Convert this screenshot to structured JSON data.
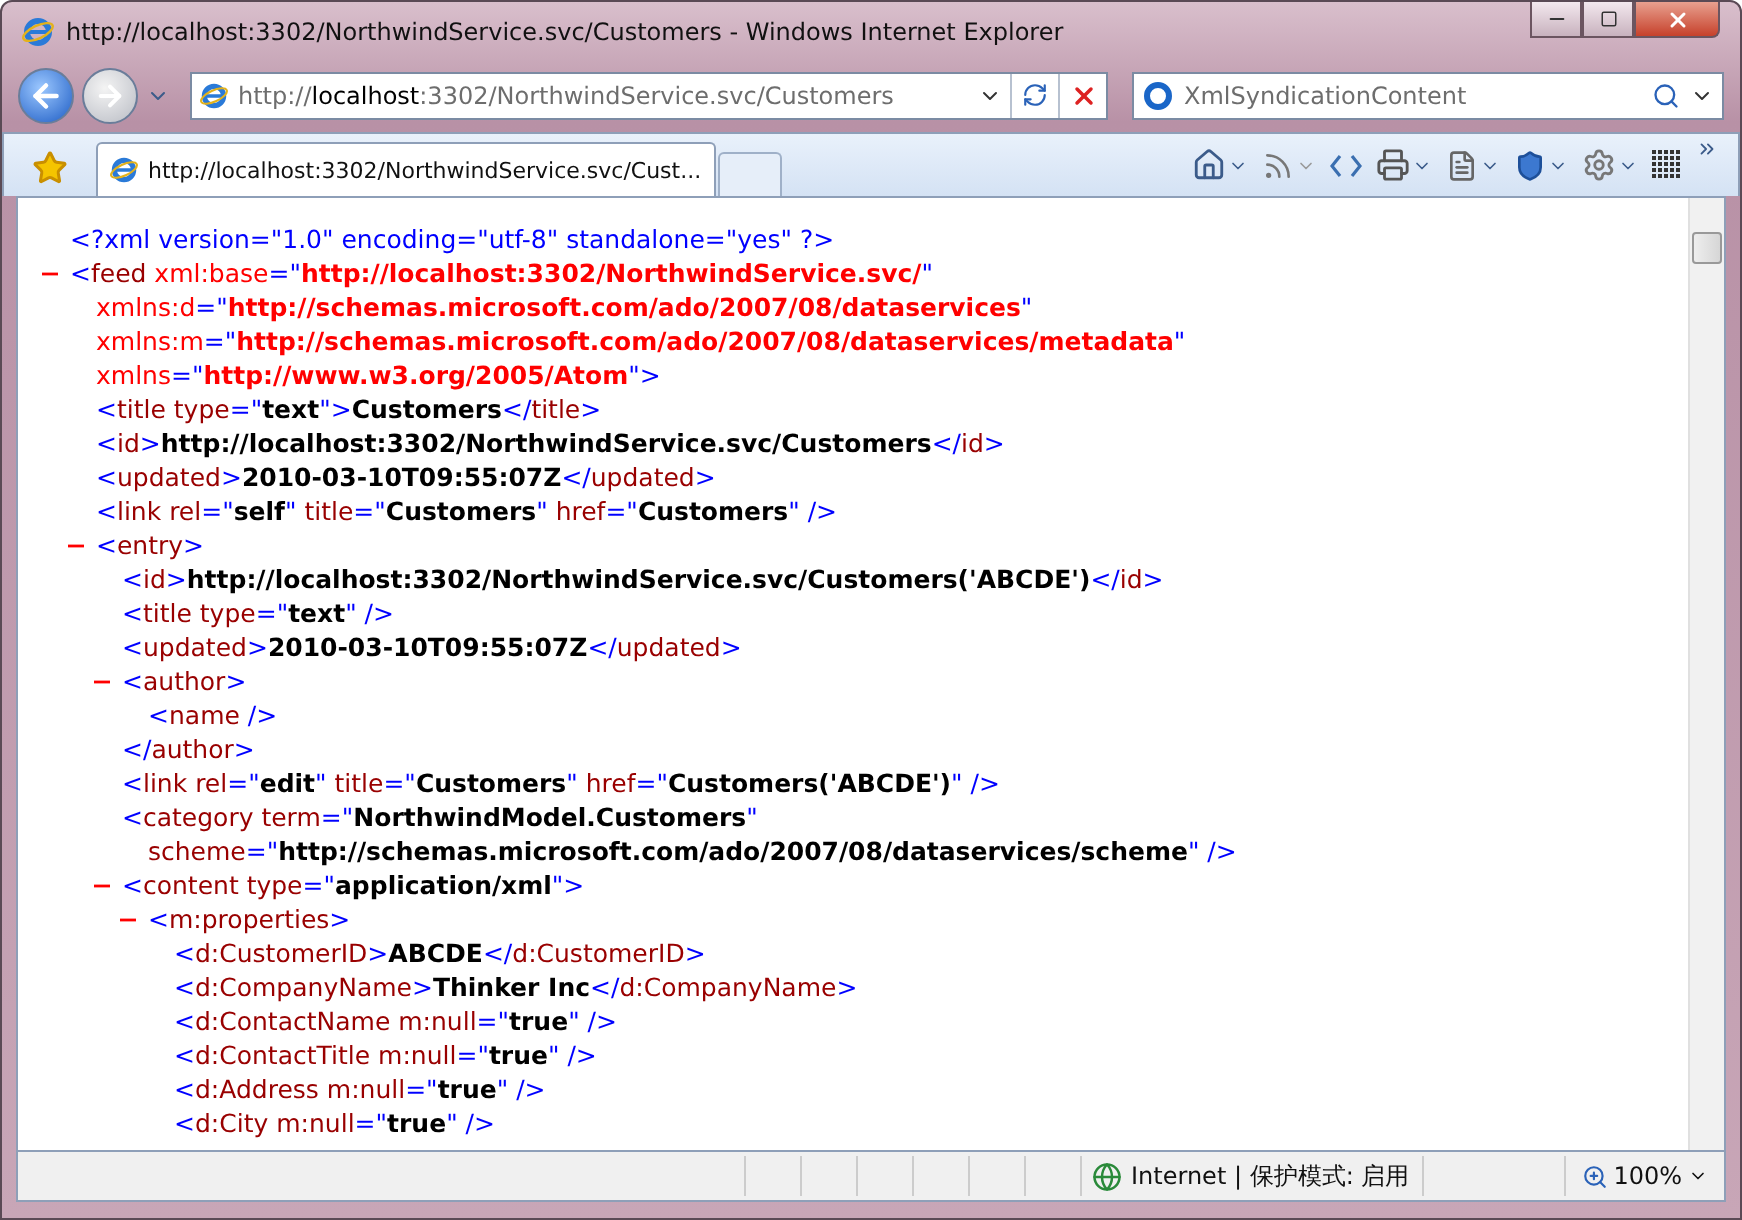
{
  "window": {
    "title": "http://localhost:3302/NorthwindService.svc/Customers - Windows Internet Explorer"
  },
  "address_bar": {
    "url": "http://**localhost**:3302/NorthwindService.svc/Customers"
  },
  "search": {
    "value": "XmlSyndicationContent"
  },
  "tabs": [
    {
      "label": "http://localhost:3302/NorthwindService.svc/Cust...",
      "selected": true
    }
  ],
  "document": [
    {
      "lines": [
        [
          {
            "kind": "pi",
            "text": "<?xml version=\"1.0\" encoding=\"utf-8\" standalone=\"yes\" ?>"
          }
        ]
      ]
    },
    {
      "expanded": true,
      "lines": [
        [
          {
            "kind": "punct",
            "text": "<"
          },
          {
            "kind": "tag",
            "text": "feed"
          },
          {
            "kind": "ns",
            "text": " xml:base"
          },
          {
            "kind": "punct",
            "text": "=\""
          },
          {
            "kind": "nsvalue",
            "text": "http://localhost:3302/NorthwindService.svc/"
          },
          {
            "kind": "punct",
            "text": "\""
          }
        ],
        [
          {
            "kind": "ns",
            "text": "xmlns:d"
          },
          {
            "kind": "punct",
            "text": "=\""
          },
          {
            "kind": "nsvalue",
            "text": "http://schemas.microsoft.com/ado/2007/08/dataservices"
          },
          {
            "kind": "punct",
            "text": "\""
          }
        ],
        [
          {
            "kind": "ns",
            "text": "xmlns:m"
          },
          {
            "kind": "punct",
            "text": "=\""
          },
          {
            "kind": "nsvalue",
            "text": "http://schemas.microsoft.com/ado/2007/08/dataservices/metadata"
          },
          {
            "kind": "punct",
            "text": "\""
          }
        ],
        [
          {
            "kind": "ns",
            "text": "xmlns"
          },
          {
            "kind": "punct",
            "text": "=\""
          },
          {
            "kind": "nsvalue",
            "text": "http://www.w3.org/2005/Atom"
          },
          {
            "kind": "punct",
            "text": "\">"
          }
        ]
      ],
      "children": [
        {
          "lines": [
            [
              {
                "kind": "punct",
                "text": "<"
              },
              {
                "kind": "tag",
                "text": "title"
              },
              {
                "kind": "attr",
                "text": " type"
              },
              {
                "kind": "punct",
                "text": "=\""
              },
              {
                "kind": "value",
                "text": "text"
              },
              {
                "kind": "punct",
                "text": "\">"
              },
              {
                "kind": "value",
                "text": "Customers"
              },
              {
                "kind": "punct",
                "text": "</"
              },
              {
                "kind": "tag",
                "text": "title"
              },
              {
                "kind": "punct",
                "text": ">"
              }
            ]
          ]
        },
        {
          "lines": [
            [
              {
                "kind": "punct",
                "text": "<"
              },
              {
                "kind": "tag",
                "text": "id"
              },
              {
                "kind": "punct",
                "text": ">"
              },
              {
                "kind": "value",
                "text": "http://localhost:3302/NorthwindService.svc/Customers"
              },
              {
                "kind": "punct",
                "text": "</"
              },
              {
                "kind": "tag",
                "text": "id"
              },
              {
                "kind": "punct",
                "text": ">"
              }
            ]
          ]
        },
        {
          "lines": [
            [
              {
                "kind": "punct",
                "text": "<"
              },
              {
                "kind": "tag",
                "text": "updated"
              },
              {
                "kind": "punct",
                "text": ">"
              },
              {
                "kind": "value",
                "text": "2010-03-10T09:55:07Z"
              },
              {
                "kind": "punct",
                "text": "</"
              },
              {
                "kind": "tag",
                "text": "updated"
              },
              {
                "kind": "punct",
                "text": ">"
              }
            ]
          ]
        },
        {
          "lines": [
            [
              {
                "kind": "punct",
                "text": "<"
              },
              {
                "kind": "tag",
                "text": "link"
              },
              {
                "kind": "attr",
                "text": " rel"
              },
              {
                "kind": "punct",
                "text": "=\""
              },
              {
                "kind": "value",
                "text": "self"
              },
              {
                "kind": "punct",
                "text": "\""
              },
              {
                "kind": "attr",
                "text": " title"
              },
              {
                "kind": "punct",
                "text": "=\""
              },
              {
                "kind": "value",
                "text": "Customers"
              },
              {
                "kind": "punct",
                "text": "\""
              },
              {
                "kind": "attr",
                "text": " href"
              },
              {
                "kind": "punct",
                "text": "=\""
              },
              {
                "kind": "value",
                "text": "Customers"
              },
              {
                "kind": "punct",
                "text": "\" />"
              }
            ]
          ]
        },
        {
          "expanded": true,
          "lines": [
            [
              {
                "kind": "punct",
                "text": "<"
              },
              {
                "kind": "tag",
                "text": "entry"
              },
              {
                "kind": "punct",
                "text": ">"
              }
            ]
          ],
          "children": [
            {
              "lines": [
                [
                  {
                    "kind": "punct",
                    "text": "<"
                  },
                  {
                    "kind": "tag",
                    "text": "id"
                  },
                  {
                    "kind": "punct",
                    "text": ">"
                  },
                  {
                    "kind": "value",
                    "text": "http://localhost:3302/NorthwindService.svc/Customers('ABCDE')"
                  },
                  {
                    "kind": "punct",
                    "text": "</"
                  },
                  {
                    "kind": "tag",
                    "text": "id"
                  },
                  {
                    "kind": "punct",
                    "text": ">"
                  }
                ]
              ]
            },
            {
              "lines": [
                [
                  {
                    "kind": "punct",
                    "text": "<"
                  },
                  {
                    "kind": "tag",
                    "text": "title"
                  },
                  {
                    "kind": "attr",
                    "text": " type"
                  },
                  {
                    "kind": "punct",
                    "text": "=\""
                  },
                  {
                    "kind": "value",
                    "text": "text"
                  },
                  {
                    "kind": "punct",
                    "text": "\" />"
                  }
                ]
              ]
            },
            {
              "lines": [
                [
                  {
                    "kind": "punct",
                    "text": "<"
                  },
                  {
                    "kind": "tag",
                    "text": "updated"
                  },
                  {
                    "kind": "punct",
                    "text": ">"
                  },
                  {
                    "kind": "value",
                    "text": "2010-03-10T09:55:07Z"
                  },
                  {
                    "kind": "punct",
                    "text": "</"
                  },
                  {
                    "kind": "tag",
                    "text": "updated"
                  },
                  {
                    "kind": "punct",
                    "text": ">"
                  }
                ]
              ]
            },
            {
              "expanded": true,
              "lines": [
                [
                  {
                    "kind": "punct",
                    "text": "<"
                  },
                  {
                    "kind": "tag",
                    "text": "author"
                  },
                  {
                    "kind": "punct",
                    "text": ">"
                  }
                ]
              ],
              "children": [
                {
                  "lines": [
                    [
                      {
                        "kind": "punct",
                        "text": "<"
                      },
                      {
                        "kind": "tag",
                        "text": "name"
                      },
                      {
                        "kind": "punct",
                        "text": " />"
                      }
                    ]
                  ]
                }
              ],
              "end": [
                {
                  "kind": "punct",
                  "text": "</"
                },
                {
                  "kind": "tag",
                  "text": "author"
                },
                {
                  "kind": "punct",
                  "text": ">"
                }
              ]
            },
            {
              "lines": [
                [
                  {
                    "kind": "punct",
                    "text": "<"
                  },
                  {
                    "kind": "tag",
                    "text": "link"
                  },
                  {
                    "kind": "attr",
                    "text": " rel"
                  },
                  {
                    "kind": "punct",
                    "text": "=\""
                  },
                  {
                    "kind": "value",
                    "text": "edit"
                  },
                  {
                    "kind": "punct",
                    "text": "\""
                  },
                  {
                    "kind": "attr",
                    "text": " title"
                  },
                  {
                    "kind": "punct",
                    "text": "=\""
                  },
                  {
                    "kind": "value",
                    "text": "Customers"
                  },
                  {
                    "kind": "punct",
                    "text": "\""
                  },
                  {
                    "kind": "attr",
                    "text": " href"
                  },
                  {
                    "kind": "punct",
                    "text": "=\""
                  },
                  {
                    "kind": "value",
                    "text": "Customers('ABCDE')"
                  },
                  {
                    "kind": "punct",
                    "text": "\" />"
                  }
                ]
              ]
            },
            {
              "lines": [
                [
                  {
                    "kind": "punct",
                    "text": "<"
                  },
                  {
                    "kind": "tag",
                    "text": "category"
                  },
                  {
                    "kind": "attr",
                    "text": " term"
                  },
                  {
                    "kind": "punct",
                    "text": "=\""
                  },
                  {
                    "kind": "value",
                    "text": "NorthwindModel.Customers"
                  },
                  {
                    "kind": "punct",
                    "text": "\""
                  }
                ],
                [
                  {
                    "kind": "attr",
                    "text": "scheme"
                  },
                  {
                    "kind": "punct",
                    "text": "=\""
                  },
                  {
                    "kind": "value",
                    "text": "http://schemas.microsoft.com/ado/2007/08/dataservices/scheme"
                  },
                  {
                    "kind": "punct",
                    "text": "\" />"
                  }
                ]
              ]
            },
            {
              "expanded": true,
              "lines": [
                [
                  {
                    "kind": "punct",
                    "text": "<"
                  },
                  {
                    "kind": "tag",
                    "text": "content"
                  },
                  {
                    "kind": "attr",
                    "text": " type"
                  },
                  {
                    "kind": "punct",
                    "text": "=\""
                  },
                  {
                    "kind": "value",
                    "text": "application/xml"
                  },
                  {
                    "kind": "punct",
                    "text": "\">"
                  }
                ]
              ],
              "children": [
                {
                  "expanded": true,
                  "lines": [
                    [
                      {
                        "kind": "punct",
                        "text": "<"
                      },
                      {
                        "kind": "tag",
                        "text": "m:properties"
                      },
                      {
                        "kind": "punct",
                        "text": ">"
                      }
                    ]
                  ],
                  "children": [
                    {
                      "lines": [
                        [
                          {
                            "kind": "punct",
                            "text": "<"
                          },
                          {
                            "kind": "tag",
                            "text": "d:CustomerID"
                          },
                          {
                            "kind": "punct",
                            "text": ">"
                          },
                          {
                            "kind": "value",
                            "text": "ABCDE"
                          },
                          {
                            "kind": "punct",
                            "text": "</"
                          },
                          {
                            "kind": "tag",
                            "text": "d:CustomerID"
                          },
                          {
                            "kind": "punct",
                            "text": ">"
                          }
                        ]
                      ]
                    },
                    {
                      "lines": [
                        [
                          {
                            "kind": "punct",
                            "text": "<"
                          },
                          {
                            "kind": "tag",
                            "text": "d:CompanyName"
                          },
                          {
                            "kind": "punct",
                            "text": ">"
                          },
                          {
                            "kind": "value",
                            "text": "Thinker Inc"
                          },
                          {
                            "kind": "punct",
                            "text": "</"
                          },
                          {
                            "kind": "tag",
                            "text": "d:CompanyName"
                          },
                          {
                            "kind": "punct",
                            "text": ">"
                          }
                        ]
                      ]
                    },
                    {
                      "lines": [
                        [
                          {
                            "kind": "punct",
                            "text": "<"
                          },
                          {
                            "kind": "tag",
                            "text": "d:ContactName"
                          },
                          {
                            "kind": "attr",
                            "text": " m:null"
                          },
                          {
                            "kind": "punct",
                            "text": "=\""
                          },
                          {
                            "kind": "value",
                            "text": "true"
                          },
                          {
                            "kind": "punct",
                            "text": "\" />"
                          }
                        ]
                      ]
                    },
                    {
                      "lines": [
                        [
                          {
                            "kind": "punct",
                            "text": "<"
                          },
                          {
                            "kind": "tag",
                            "text": "d:ContactTitle"
                          },
                          {
                            "kind": "attr",
                            "text": " m:null"
                          },
                          {
                            "kind": "punct",
                            "text": "=\""
                          },
                          {
                            "kind": "value",
                            "text": "true"
                          },
                          {
                            "kind": "punct",
                            "text": "\" />"
                          }
                        ]
                      ]
                    },
                    {
                      "lines": [
                        [
                          {
                            "kind": "punct",
                            "text": "<"
                          },
                          {
                            "kind": "tag",
                            "text": "d:Address"
                          },
                          {
                            "kind": "attr",
                            "text": " m:null"
                          },
                          {
                            "kind": "punct",
                            "text": "=\""
                          },
                          {
                            "kind": "value",
                            "text": "true"
                          },
                          {
                            "kind": "punct",
                            "text": "\" />"
                          }
                        ]
                      ]
                    },
                    {
                      "lines": [
                        [
                          {
                            "kind": "punct",
                            "text": "<"
                          },
                          {
                            "kind": "tag",
                            "text": "d:City"
                          },
                          {
                            "kind": "attr",
                            "text": " m:null"
                          },
                          {
                            "kind": "punct",
                            "text": "=\""
                          },
                          {
                            "kind": "value",
                            "text": "true"
                          },
                          {
                            "kind": "punct",
                            "text": "\" />"
                          }
                        ]
                      ]
                    }
                  ]
                }
              ]
            }
          ]
        }
      ]
    }
  ],
  "status_bar": {
    "zone": "Internet | 保护模式: 启用",
    "zoom": "100%"
  }
}
